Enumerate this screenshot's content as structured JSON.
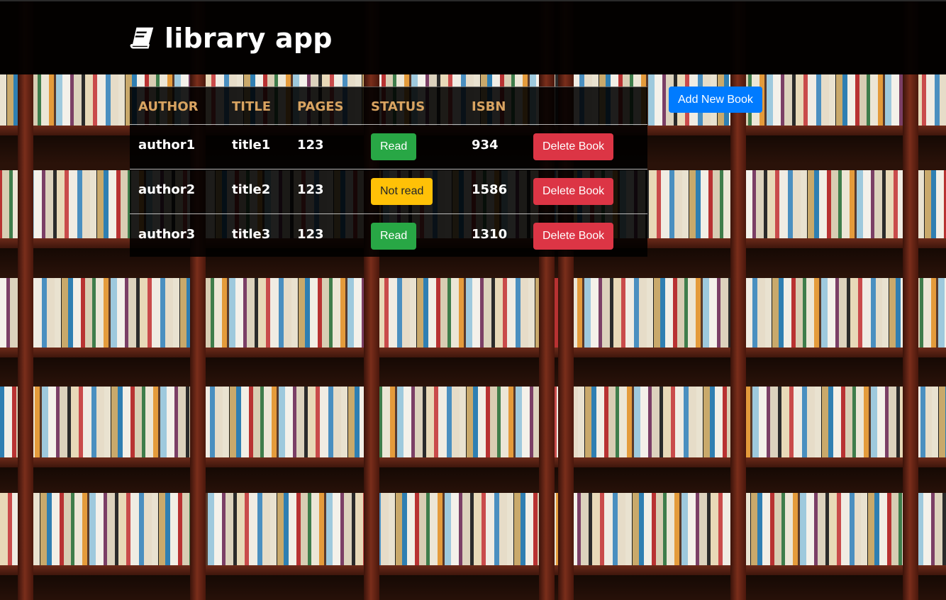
{
  "header": {
    "title": "library app",
    "icon": "book-icon"
  },
  "table": {
    "columns": [
      "AUTHOR",
      "TITLE",
      "PAGES",
      "STATUS",
      "ISBN"
    ],
    "rows": [
      {
        "author": "author1",
        "title": "title1",
        "pages": "123",
        "status": "Read",
        "isbn": "934",
        "delete_label": "Delete Book"
      },
      {
        "author": "author2",
        "title": "title2",
        "pages": "123",
        "status": "Not read",
        "isbn": "1586",
        "delete_label": "Delete Book"
      },
      {
        "author": "author3",
        "title": "title3",
        "pages": "123",
        "status": "Read",
        "isbn": "1310",
        "delete_label": "Delete Book"
      }
    ]
  },
  "actions": {
    "add_label": "Add New Book"
  },
  "colors": {
    "header_text": "#d9a461",
    "read": "#28a745",
    "not_read": "#ffc107",
    "delete": "#dc3545",
    "add": "#007bff"
  }
}
